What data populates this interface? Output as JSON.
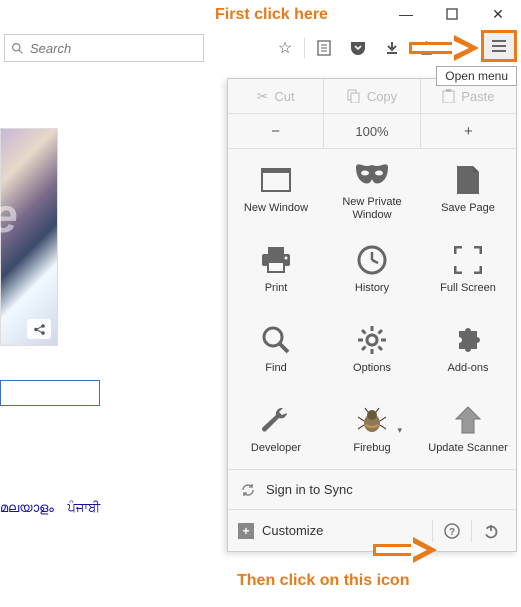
{
  "annotations": {
    "first": "First click here",
    "second": "Then click on this icon"
  },
  "tooltip": "Open menu",
  "search": {
    "placeholder": "Search"
  },
  "clipboard": {
    "cut": "Cut",
    "copy": "Copy",
    "paste": "Paste"
  },
  "zoom": {
    "minus": "−",
    "level": "100%",
    "plus": "+"
  },
  "grid": {
    "new_window": "New Window",
    "new_private": "New Private Window",
    "save_page": "Save Page",
    "print": "Print",
    "history": "History",
    "full_screen": "Full Screen",
    "find": "Find",
    "options": "Options",
    "addons": "Add-ons",
    "developer": "Developer",
    "firebug": "Firebug",
    "update_scanner": "Update Scanner"
  },
  "sync": "Sign in to Sync",
  "customize": "Customize",
  "langs": {
    "ml": "മലയാളം",
    "pa": "ਪੰਜਾਬੀ"
  }
}
